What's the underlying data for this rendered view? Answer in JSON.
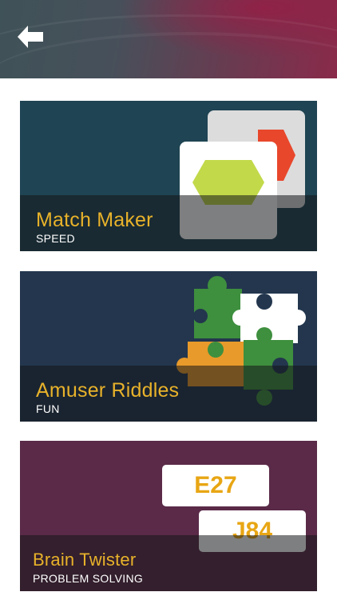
{
  "header": {
    "back_icon": "arrow-left-icon"
  },
  "games": [
    {
      "title": "Match Maker",
      "subtitle": "SPEED",
      "bg": "#1f4453"
    },
    {
      "title": "Amuser Riddles",
      "subtitle": "FUN",
      "bg": "#23364e"
    },
    {
      "title": "Brain Twister",
      "subtitle": "PROBLEM SOLVING",
      "bg": "#5a2a48",
      "codes": [
        "E27",
        "J84"
      ]
    }
  ],
  "colors": {
    "accent": "#e8b22a",
    "hexagon_green": "#c2d94a",
    "hexagon_red": "#e8472c"
  }
}
